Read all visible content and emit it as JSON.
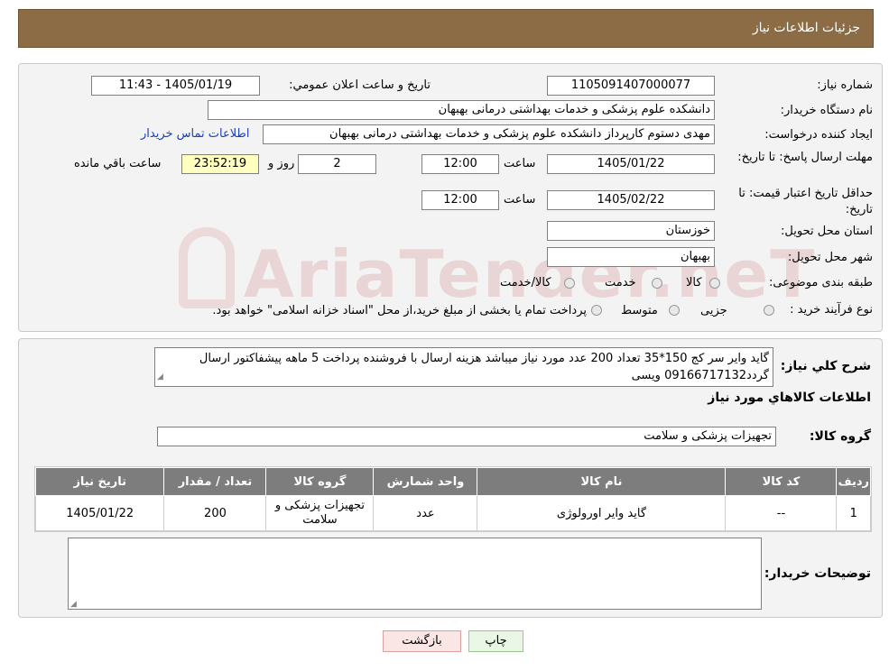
{
  "header": {
    "title": "جزئیات اطلاعات نیاز"
  },
  "form": {
    "need_number_label": "شماره نياز:",
    "need_number_value": "1105091407000077",
    "announce_label": "تاريخ و ساعت اعلان عمومي:",
    "announce_value": "1405/01/19 - 11:43",
    "buyer_label": "نام دستگاه خريدار:",
    "buyer_value": "دانشکده علوم پزشکی و خدمات بهداشتی  درمانی بهبهان",
    "creator_label": "ايجاد کننده درخواست:",
    "creator_value": "مهدی دستوم کارپرداز دانشکده علوم پزشکی و خدمات بهداشتی  درمانی بهبهان",
    "contact_link": "اطلاعات تماس خريدار",
    "reply_deadline_label": "مهلت ارسال پاسخ: تا تاريخ:",
    "reply_date": "1405/01/22",
    "time_label": "ساعت",
    "reply_time": "12:00",
    "days_value": "2",
    "days_label": "روز و",
    "remaining_value": "23:52:19",
    "remaining_label": "ساعت باقي مانده",
    "price_validity_label": "حداقل تاريخ اعتبار قيمت: تا تاريخ:",
    "price_date": "1405/02/22",
    "price_time": "12:00",
    "province_label": "استان محل تحويل:",
    "province_value": "خوزستان",
    "city_label": "شهر محل تحويل:",
    "city_value": "بهبهان",
    "category_label": "طبقه بندی موضوعی:",
    "category_options": [
      "کالا",
      "خدمت",
      "کالا/خدمت"
    ],
    "process_label": "نوع فرآيند خريد :",
    "process_options": [
      "جزیی",
      "متوسط"
    ],
    "process_note": "پرداخت تمام يا بخشی از مبلغ خريد،از محل \"اسناد خزانه اسلامی\" خواهد بود."
  },
  "watermark": "AriaTender.neT",
  "description": {
    "label": "شرح کلي نياز:",
    "text": "گاید وایر سر کج 150*35 تعداد 200 عدد مورد نیاز میباشد هزینه ارسال با فروشنده پرداخت 5 ماهه پیشفاکتور ارسال گردد09166717132 ویسی"
  },
  "goods_info": {
    "title": "اطلاعات کالاهاي مورد نياز",
    "group_label": "گروه کالا:",
    "group_value": "تجهیزات پزشکی و سلامت",
    "columns": [
      "رديف",
      "کد کالا",
      "نام کالا",
      "واحد شمارش",
      "گروه کالا",
      "تعداد / مقدار",
      "تاريخ نياز"
    ],
    "rows": [
      {
        "row": "1",
        "code": "--",
        "name": "گاید وایر اورولوژی",
        "unit": "عدد",
        "group": "تجهیزات پزشکی و سلامت",
        "qty": "200",
        "date": "1405/01/22"
      }
    ]
  },
  "buyer_notes": {
    "label": "توضيحات خريدار:",
    "value": ""
  },
  "buttons": {
    "print": "چاپ",
    "back": "بازگشت"
  }
}
